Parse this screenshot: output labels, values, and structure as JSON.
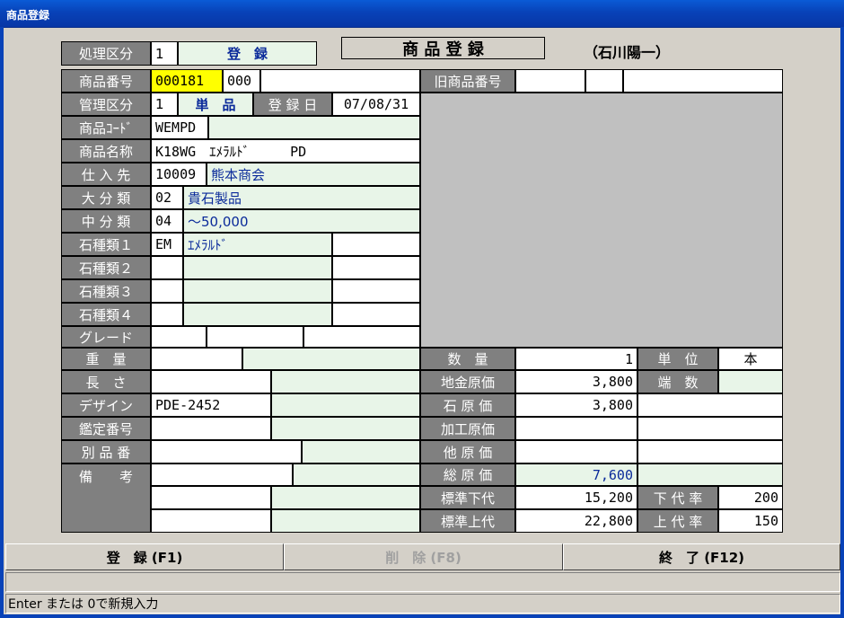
{
  "window": {
    "title": "商品登録"
  },
  "header": {
    "mode_label": "処理区分",
    "mode_code": "1",
    "mode_value": "登　録",
    "screen_title": "商 品 登 録",
    "user": "（石川陽一）"
  },
  "left": {
    "product_no": {
      "label": "商品番号",
      "value": "000181",
      "sub": "000"
    },
    "mgmt": {
      "label": "管理区分",
      "code": "1",
      "value": "単　品",
      "date_label": "登 録 日",
      "date": "07/08/31"
    },
    "code": {
      "label": "商品ｺｰﾄﾞ",
      "value": "WEMPD"
    },
    "name": {
      "label": "商品名称",
      "value": "K18WG　ｴﾒﾗﾙﾄﾞ　　　PD"
    },
    "supplier": {
      "label": "仕 入 先",
      "code": "10009",
      "value": "熊本商会"
    },
    "major": {
      "label": "大 分 類",
      "code": "02",
      "value": "貴石製品"
    },
    "middle": {
      "label": "中 分 類",
      "code": "04",
      "value": "～50,000"
    },
    "stone1": {
      "label": "石種類１",
      "code": "EM",
      "value": "ｴﾒﾗﾙﾄﾞ"
    },
    "stone2": {
      "label": "石種類２"
    },
    "stone3": {
      "label": "石種類３"
    },
    "stone4": {
      "label": "石種類４"
    },
    "grade": {
      "label": "グレード"
    },
    "weight": {
      "label": "重　量"
    },
    "length": {
      "label": "長　さ"
    },
    "design": {
      "label": "デザイン",
      "value": "PDE-2452"
    },
    "appraisal": {
      "label": "鑑定番号"
    },
    "alt_no": {
      "label": "別 品 番"
    },
    "remarks": {
      "label": "備　　考"
    }
  },
  "right": {
    "old_no": {
      "label": "旧商品番号"
    },
    "qty": {
      "label": "数　量",
      "value": "1",
      "unit_label": "単　位",
      "unit": "本"
    },
    "metal": {
      "label": "地金原価",
      "value": "3,800",
      "frac_label": "端　数"
    },
    "stone": {
      "label": "石 原 価",
      "value": "3,800"
    },
    "process": {
      "label": "加工原価"
    },
    "other": {
      "label": "他 原 価"
    },
    "total": {
      "label": "総 原 価",
      "value": "7,600"
    },
    "std_lower": {
      "label": "標準下代",
      "value": "15,200",
      "rate_label": "下 代 率",
      "rate": "200"
    },
    "std_upper": {
      "label": "標準上代",
      "value": "22,800",
      "rate_label": "上 代 率",
      "rate": "150"
    }
  },
  "buttons": {
    "register": "登　録 (F1)",
    "delete": "削　除 (F8)",
    "exit": "終　了 (F12)"
  },
  "status": {
    "message": "Enter または 0で新規入力"
  }
}
